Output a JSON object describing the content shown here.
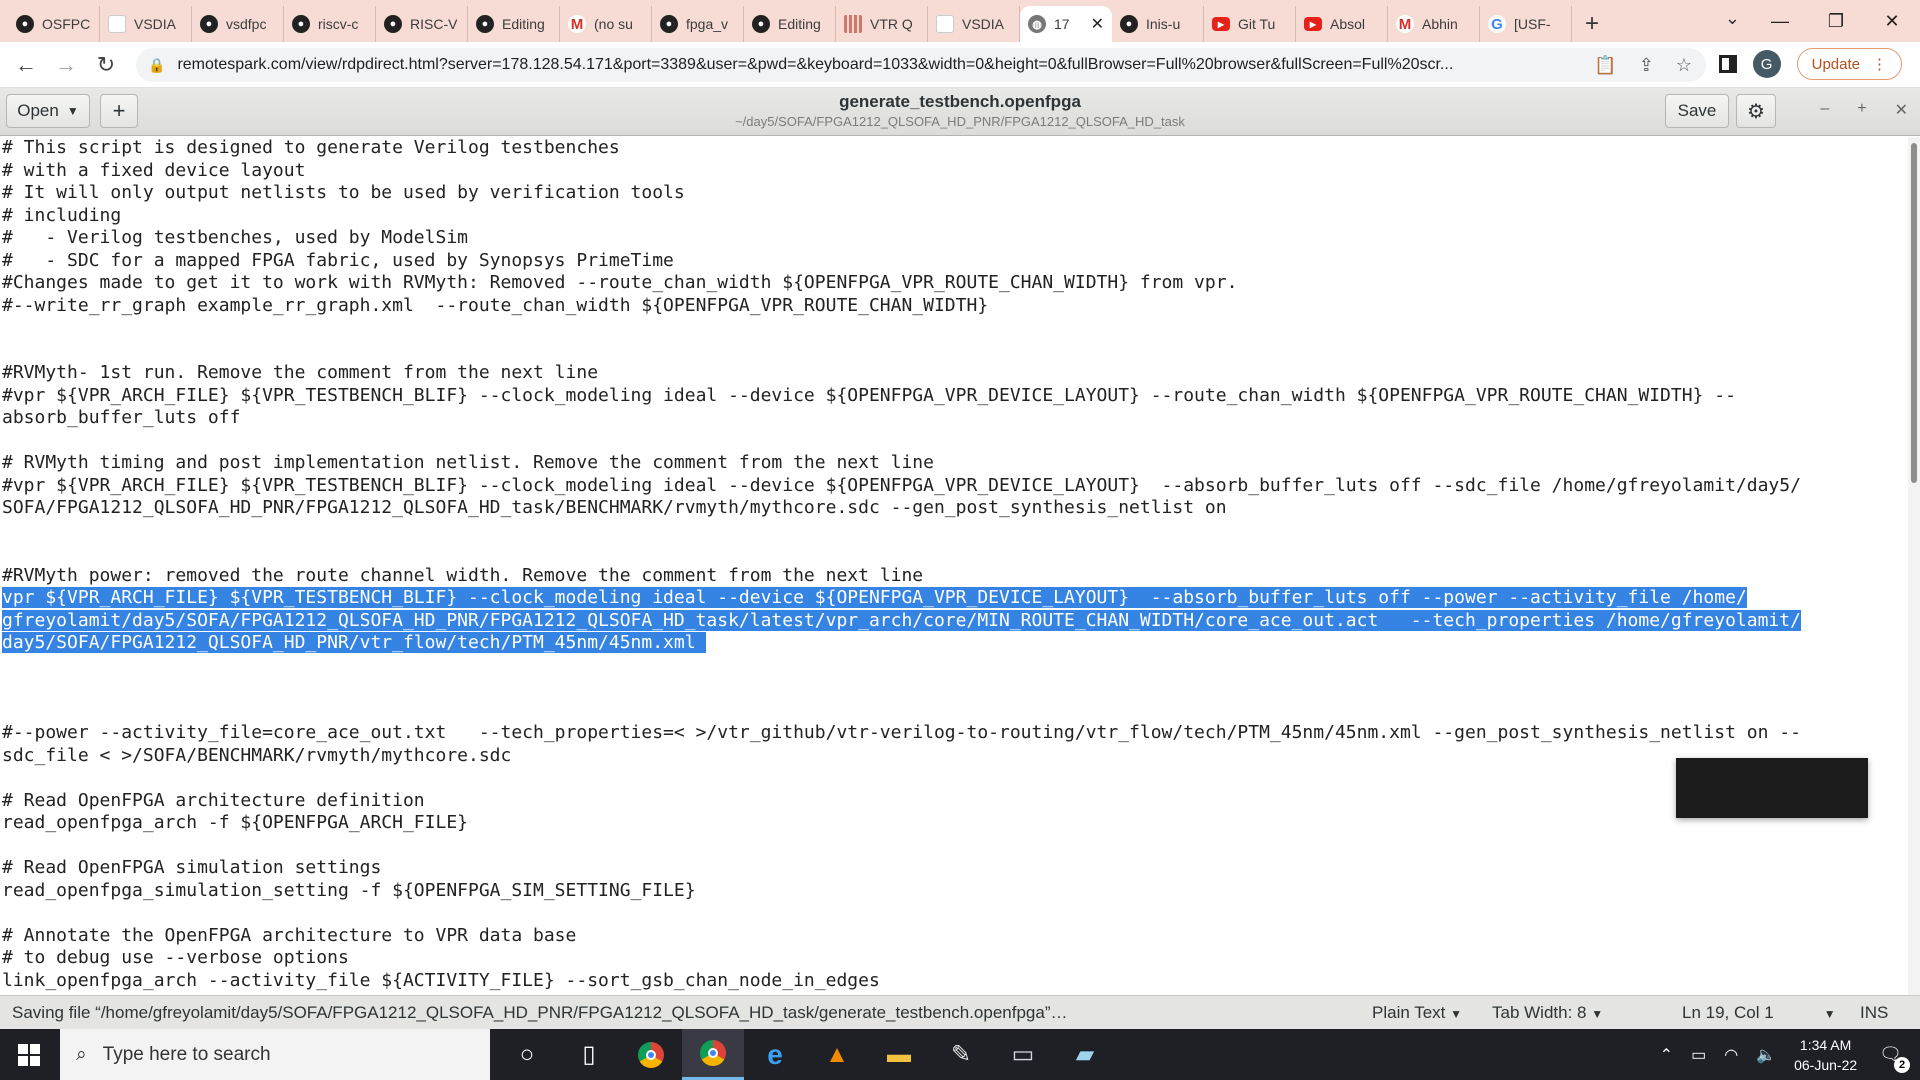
{
  "browser": {
    "tabs": [
      {
        "title": "OSFPC",
        "icon": "github-icon"
      },
      {
        "title": "VSDIA",
        "icon": "document-icon"
      },
      {
        "title": "vsdfpc",
        "icon": "github-icon"
      },
      {
        "title": "riscv-c",
        "icon": "github-icon"
      },
      {
        "title": "RISC-V",
        "icon": "github-icon"
      },
      {
        "title": "Editing",
        "icon": "github-icon"
      },
      {
        "title": "(no su",
        "icon": "gmail-icon"
      },
      {
        "title": "fpga_v",
        "icon": "github-icon"
      },
      {
        "title": "Editing",
        "icon": "github-icon"
      },
      {
        "title": "VTR Q",
        "icon": "grid-icon"
      },
      {
        "title": "VSDIA",
        "icon": "document-icon"
      },
      {
        "title": "17",
        "icon": "globe-icon",
        "active": true
      },
      {
        "title": "Inis-u",
        "icon": "github-icon"
      },
      {
        "title": "Git Tu",
        "icon": "youtube-icon"
      },
      {
        "title": "Absol",
        "icon": "youtube-icon"
      },
      {
        "title": "Abhin",
        "icon": "gmail-icon"
      },
      {
        "title": "[USF-",
        "icon": "google-icon"
      }
    ],
    "new_tab_label": "+",
    "url": "remotespark.com/view/rdpdirect.html?server=178.128.54.171&port=3389&user=&pwd=&keyboard=1033&width=0&height=0&fullBrowser=Full%20browser&fullScreen=Full%20scr...",
    "avatar_initial": "G",
    "update_label": "Update"
  },
  "editor_app": {
    "open_label": "Open",
    "title": "generate_testbench.openfpga",
    "subtitle": "~/day5/SOFA/FPGA1212_QLSOFA_HD_PNR/FPGA1212_QLSOFA_HD_task",
    "save_label": "Save"
  },
  "code_lines": [
    {
      "text": "# This script is designed to generate Verilog testbenches"
    },
    {
      "text": "# with a fixed device layout"
    },
    {
      "text": "# It will only output netlists to be used by verification tools"
    },
    {
      "text": "# including"
    },
    {
      "text": "#   - Verilog testbenches, used by ModelSim"
    },
    {
      "text": "#   - SDC for a mapped FPGA fabric, used by Synopsys PrimeTime"
    },
    {
      "text": "#Changes made to get it to work with RVMyth: Removed --route_chan_width ${OPENFPGA_VPR_ROUTE_CHAN_WIDTH} from vpr."
    },
    {
      "text": "#--write_rr_graph example_rr_graph.xml  --route_chan_width ${OPENFPGA_VPR_ROUTE_CHAN_WIDTH}"
    },
    {
      "text": ""
    },
    {
      "text": ""
    },
    {
      "text": "#RVMyth- 1st run. Remove the comment from the next line"
    },
    {
      "text": "#vpr ${VPR_ARCH_FILE} ${VPR_TESTBENCH_BLIF} --clock_modeling ideal --device ${OPENFPGA_VPR_DEVICE_LAYOUT} --route_chan_width ${OPENFPGA_VPR_ROUTE_CHAN_WIDTH} --"
    },
    {
      "text": "absorb_buffer_luts off"
    },
    {
      "text": ""
    },
    {
      "text": "# RVMyth timing and post implementation netlist. Remove the comment from the next line"
    },
    {
      "text": "#vpr ${VPR_ARCH_FILE} ${VPR_TESTBENCH_BLIF} --clock_modeling ideal --device ${OPENFPGA_VPR_DEVICE_LAYOUT}  --absorb_buffer_luts off --sdc_file /home/gfreyolamit/day5/"
    },
    {
      "text": "SOFA/FPGA1212_QLSOFA_HD_PNR/FPGA1212_QLSOFA_HD_task/BENCHMARK/rvmyth/mythcore.sdc --gen_post_synthesis_netlist on"
    },
    {
      "text": ""
    },
    {
      "text": ""
    },
    {
      "text": "#RVMyth power: removed the route channel width. Remove the comment from the next line"
    },
    {
      "text": "vpr ${VPR_ARCH_FILE} ${VPR_TESTBENCH_BLIF} --clock_modeling ideal --device ${OPENFPGA_VPR_DEVICE_LAYOUT}  --absorb_buffer_luts off --power --activity_file /home/",
      "selected": true
    },
    {
      "text": "gfreyolamit/day5/SOFA/FPGA1212_QLSOFA_HD_PNR/FPGA1212_QLSOFA_HD_task/latest/vpr_arch/core/MIN_ROUTE_CHAN_WIDTH/core_ace_out.act   --tech_properties /home/gfreyolamit/",
      "selected": true
    },
    {
      "text": "day5/SOFA/FPGA1212_QLSOFA_HD_PNR/vtr_flow/tech/PTM_45nm/45nm.xml ",
      "selected": true
    },
    {
      "text": ""
    },
    {
      "text": ""
    },
    {
      "text": ""
    },
    {
      "text": "#--power --activity_file=core_ace_out.txt   --tech_properties=< >/vtr_github/vtr-verilog-to-routing/vtr_flow/tech/PTM_45nm/45nm.xml --gen_post_synthesis_netlist on --"
    },
    {
      "text": "sdc_file < >/SOFA/BENCHMARK/rvmyth/mythcore.sdc"
    },
    {
      "text": ""
    },
    {
      "text": "# Read OpenFPGA architecture definition"
    },
    {
      "text": "read_openfpga_arch -f ${OPENFPGA_ARCH_FILE}"
    },
    {
      "text": ""
    },
    {
      "text": "# Read OpenFPGA simulation settings"
    },
    {
      "text": "read_openfpga_simulation_setting -f ${OPENFPGA_SIM_SETTING_FILE}"
    },
    {
      "text": ""
    },
    {
      "text": "# Annotate the OpenFPGA architecture to VPR data base"
    },
    {
      "text": "# to debug use --verbose options"
    },
    {
      "text": "link_openfpga_arch --activity_file ${ACTIVITY_FILE} --sort_gsb_chan_node_in_edges"
    }
  ],
  "statusbar": {
    "message": "Saving file “/home/gfreyolamit/day5/SOFA/FPGA1212_QLSOFA_HD_PNR/FPGA1212_QLSOFA_HD_task/generate_testbench.openfpga”…",
    "language": "Plain Text",
    "tab_width": "Tab Width: 8",
    "cursor": "Ln 19, Col 1",
    "mode": "INS"
  },
  "taskbar": {
    "search_placeholder": "Type here to search",
    "time": "1:34 AM",
    "date": "06-Jun-22",
    "notification_count": "2"
  }
}
